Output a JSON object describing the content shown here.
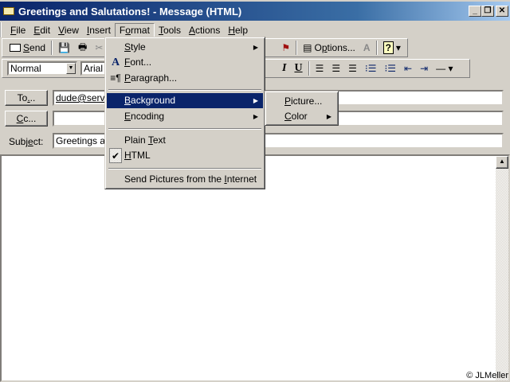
{
  "window": {
    "title": "Greetings and Salutations! - Message (HTML)",
    "min": "_",
    "restore": "❐",
    "close": "✕"
  },
  "menubar": [
    "File",
    "Edit",
    "View",
    "Insert",
    "Format",
    "Tools",
    "Actions",
    "Help"
  ],
  "toolbar": {
    "send": "Send",
    "options": "Options...",
    "help": "?"
  },
  "formatting": {
    "style": "Normal",
    "font": "Arial",
    "italic": "I",
    "underline": "U"
  },
  "header": {
    "to_label": "To...",
    "to_value": "dude@serve",
    "cc_label": "Cc...",
    "cc_value": "",
    "subject_label": "Subject:",
    "subject_value": "Greetings an"
  },
  "format_menu": {
    "style": "Style",
    "font": "Font...",
    "paragraph": "Paragraph...",
    "background": "Background",
    "encoding": "Encoding",
    "plain_text": "Plain Text",
    "html": "HTML",
    "send_pictures": "Send Pictures from the Internet"
  },
  "background_submenu": {
    "picture": "Picture...",
    "color": "Color"
  },
  "copyright": "© JLMeller",
  "colors": {
    "title": "#0a246a",
    "highlight": "#0a246a",
    "face": "#d4d0c8"
  }
}
